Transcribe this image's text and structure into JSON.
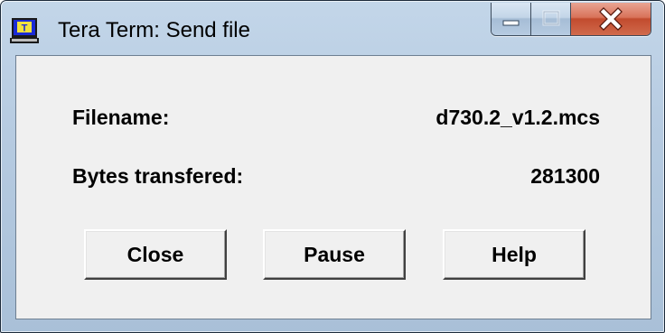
{
  "window": {
    "title": "Tera Term: Send file"
  },
  "fields": {
    "filename_label": "Filename:",
    "filename_value": "d730.2_v1.2.mcs",
    "bytes_label": "Bytes transfered:",
    "bytes_value": "281300"
  },
  "buttons": {
    "close_label": "Close",
    "pause_label": "Pause",
    "help_label": "Help"
  },
  "icons": {
    "app": "tera-term-icon",
    "minimize": "minimize-icon",
    "maximize": "maximize-icon",
    "close": "close-icon"
  },
  "colors": {
    "titlebar": "#b9cde2",
    "client_background": "#f0f0f0",
    "close_button": "#c94f33"
  }
}
